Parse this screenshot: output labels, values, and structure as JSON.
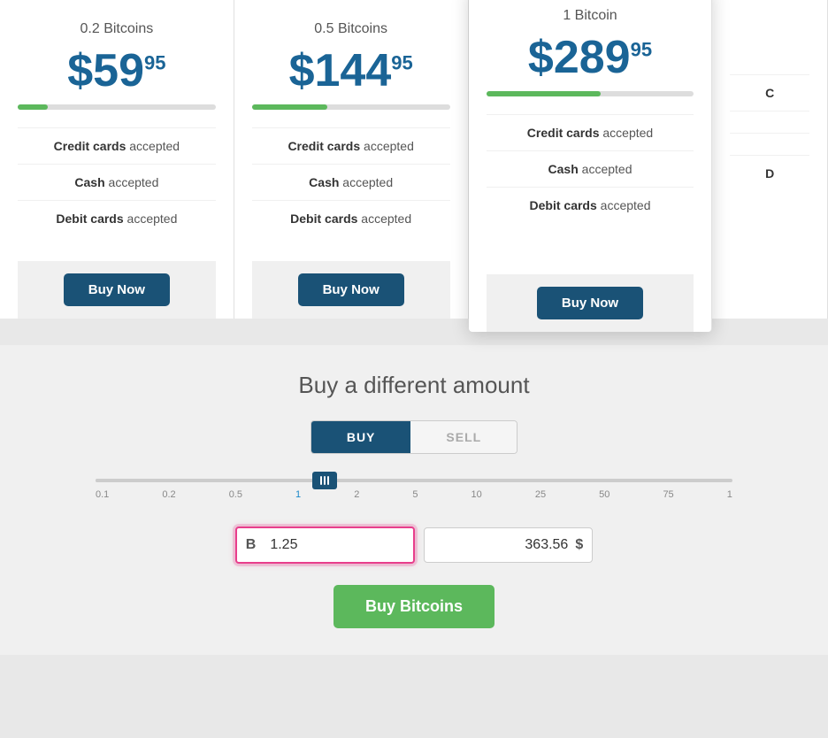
{
  "cards": [
    {
      "id": "card-0-2",
      "title": "0.2 Bitcoins",
      "price_main": "$59",
      "price_cents": "95",
      "bar_width": "15%",
      "features": [
        {
          "bold": "Credit cards",
          "text": " accepted"
        },
        {
          "bold": "Cash",
          "text": " accepted"
        },
        {
          "bold": "Debit cards",
          "text": " accepted"
        }
      ],
      "button_label": "Buy Now",
      "featured": false
    },
    {
      "id": "card-0-5",
      "title": "0.5 Bitcoins",
      "price_main": "$144",
      "price_cents": "95",
      "bar_width": "38%",
      "features": [
        {
          "bold": "Credit cards",
          "text": " accepted"
        },
        {
          "bold": "Cash",
          "text": " accepted"
        },
        {
          "bold": "Debit cards",
          "text": " accepted"
        }
      ],
      "button_label": "Buy Now",
      "featured": false
    },
    {
      "id": "card-1",
      "title": "1 Bitcoin",
      "price_main": "$289",
      "price_cents": "95",
      "bar_width": "55%",
      "features": [
        {
          "bold": "Credit cards",
          "text": " accepted"
        },
        {
          "bold": "Cash",
          "text": " accepted"
        },
        {
          "bold": "Debit cards",
          "text": " accepted"
        }
      ],
      "button_label": "Buy Now",
      "featured": true
    }
  ],
  "section_title": "Buy a different amount",
  "toggle": {
    "buy_label": "BUY",
    "sell_label": "SELL"
  },
  "slider": {
    "labels": [
      "0.1",
      "0.2",
      "0.5",
      "1",
      "2",
      "5",
      "10",
      "25",
      "50",
      "75",
      "1"
    ],
    "highlighted_index": 3
  },
  "btc_input": {
    "symbol": "B",
    "value": "1.25",
    "placeholder": "1.25"
  },
  "usd_input": {
    "value": "363.56",
    "symbol": "$"
  },
  "buy_button": {
    "label": "Buy Bitcoins"
  }
}
